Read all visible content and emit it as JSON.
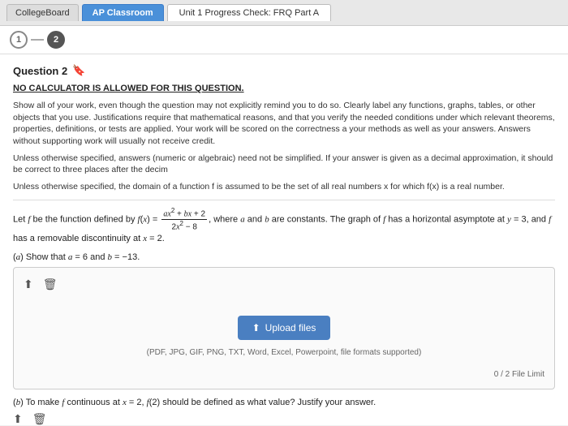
{
  "topbar": {
    "tab_collegeboard": "CollegeBoard",
    "tab_apclassroom": "AP Classroom",
    "tab_unit": "Unit 1 Progress Check: FRQ Part A"
  },
  "breadcrumb": {
    "step1_label": "1",
    "step2_label": "2",
    "step1_active": false,
    "step2_active": true
  },
  "question": {
    "number": "Question 2",
    "no_calc": "NO CALCULATOR IS ALLOWED FOR THIS QUESTION.",
    "instructions": [
      "Show all of your work, even though the question may not explicitly remind you to do so. Clearly label any functions, graphs, tables, or other objects that you use. Justifications require that mathematical reasons, and that you verify the needed conditions under which relevant theorems, properties, definitions, or tests are applied. Your work will be scored on the correctness a your methods as well as your answers. Answers without supporting work will usually not receive credit.",
      "Unless otherwise specified, answers (numeric or algebraic) need not be simplified. If your answer is given as a decimal approximation, it should be correct to three places after the decim",
      "Unless otherwise specified, the domain of a function f is assumed to be the set of all real numbers x for which f(x) is a real number."
    ],
    "function_def": "Let f be the function defined by f(x) = (ax² + bx + 2) / (2x² - 8), where a and b are constants. The graph of f has a horizontal asymptote at y = 3, and f has a removable discontinuity at x = 2.",
    "part_a_label": "(a) Show that a = 6 and b = -13.",
    "part_b_label": "(b) To make f continuous at x = 2, f(2) should be defined as what value? Justify your answer.",
    "upload": {
      "button_label": "Upload files",
      "formats_text": "(PDF, JPG, GIF, PNG, TXT, Word, Excel, Powerpoint, file formats supported)",
      "file_limit_text": "0 / 2 File Limit"
    }
  }
}
